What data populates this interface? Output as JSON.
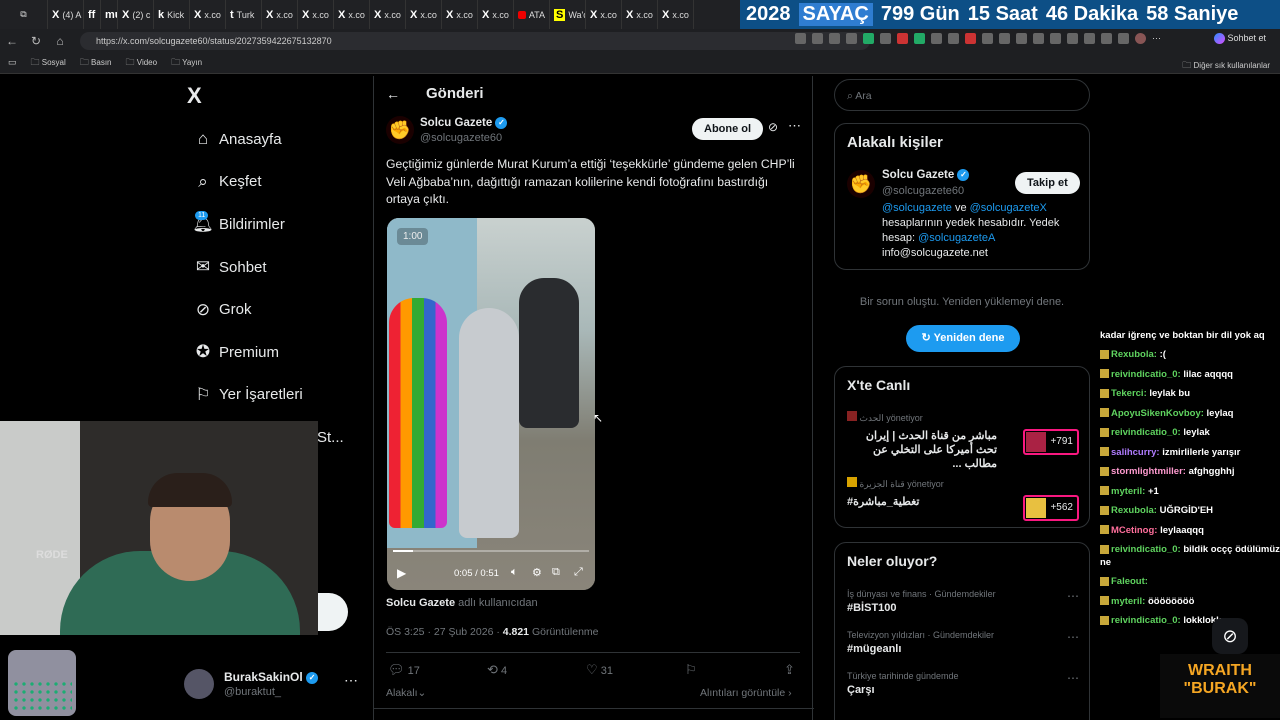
{
  "browser": {
    "tabs": [
      {
        "label": "(4) A",
        "icon": "X"
      },
      {
        "label": "",
        "icon": "ff"
      },
      {
        "label": "",
        "icon": "mute"
      },
      {
        "label": "(2) c",
        "icon": "X"
      },
      {
        "label": "Kick",
        "icon": "k"
      },
      {
        "label": "x.co",
        "icon": "X"
      },
      {
        "label": "Turk",
        "icon": "t"
      },
      {
        "label": "x.co",
        "icon": "X"
      },
      {
        "label": "x.co",
        "icon": "X"
      },
      {
        "label": "x.co",
        "icon": "X"
      },
      {
        "label": "x.co",
        "icon": "X"
      },
      {
        "label": "x.co",
        "icon": "X"
      },
      {
        "label": "x.co",
        "icon": "X"
      },
      {
        "label": "x.co",
        "icon": "X"
      },
      {
        "label": "ATA",
        "icon": "yt"
      },
      {
        "label": "Wa'c",
        "icon": "S"
      },
      {
        "label": "x.co",
        "icon": "X"
      },
      {
        "label": "x.co",
        "icon": "X"
      },
      {
        "label": "x.co",
        "icon": "X"
      }
    ],
    "url": "https://x.com/solcugazete60/status/2027359422675132870",
    "copilot_label": "Sohbet et",
    "bookmarks": [
      "Sosyal",
      "Basın",
      "Video",
      "Yayın"
    ],
    "other_bookmarks": "Diğer sık kullanılanlar"
  },
  "counter": {
    "year": "2028",
    "label": "SAYAÇ",
    "days": "799 Gün",
    "hours": "15 Saat",
    "minutes": "46 Dakika",
    "seconds": "58 Saniye"
  },
  "nav": {
    "logo": "X",
    "items": [
      {
        "label": "Anasayfa",
        "icon": "home-icon"
      },
      {
        "label": "Keşfet",
        "icon": "search-icon"
      },
      {
        "label": "Bildirimler",
        "icon": "bell-icon",
        "badge": "11"
      },
      {
        "label": "Sohbet",
        "icon": "mail-icon"
      },
      {
        "label": "Grok",
        "icon": "grok-icon"
      },
      {
        "label": "Premium",
        "icon": "premium-icon"
      },
      {
        "label": "Yer İşaretleri",
        "icon": "bookmark-icon"
      }
    ],
    "more_partial": "St...",
    "user": {
      "name": "BurakSakinOl",
      "handle": "@buraktut_"
    }
  },
  "post": {
    "header": "Gönderi",
    "author": {
      "name": "Solcu Gazete",
      "handle": "@solcugazete60"
    },
    "subscribe": "Abone ol",
    "text": "Geçtiğimiz günlerde Murat Kurum’a ettiği ‘teşekkürle’ gündeme gelen CHP’li Veli Ağbaba’nın, dağıttığı ramazan kolilerine kendi fotoğrafını bastırdığı ortaya çıktı.",
    "video": {
      "overlay_time": "1:00",
      "time": "0:05 / 0:51",
      "progress": 0.1
    },
    "from_user": "Solcu Gazete",
    "from_suffix": "adlı kullanıcıdan",
    "timestamp": "ÖS 3:25 · 27 Şub 2026 ·",
    "views": "4.821",
    "views_label": "Görüntülenme",
    "stats": {
      "replies": "17",
      "reposts": "4",
      "likes": "31"
    },
    "related": "Alakalı",
    "quotes": "Alıntıları görüntüle"
  },
  "right": {
    "search_placeholder": "Ara",
    "related_title": "Alakalı kişiler",
    "person": {
      "name": "Solcu Gazete",
      "handle": "@solcugazete60",
      "follow": "Takip et",
      "bio_link1": "@solcugazete",
      "bio_and": "ve",
      "bio_link2": "@solcugazeteX",
      "bio_text": "hesaplarının yedek hesabıdır. Yedek hesap:",
      "bio_link3": "@solcugazeteA",
      "bio_email": "info@solcugazete.net"
    },
    "error": "Bir sorun oluştu. Yeniden yüklemeyi dene.",
    "retry": "Yeniden dene",
    "live_title": "X'te Canlı",
    "live": [
      {
        "host": "الحدث",
        "role": "yönetiyor",
        "title": "مباشر من قناة الحدث | إيران تحث أميركا على التخلي عن مطالب ...",
        "count": "+791"
      },
      {
        "host": "قناة الجزيرة",
        "role": "yönetiyor",
        "title": "#تغطية_مباشرة",
        "count": "+562"
      }
    ],
    "trends_title": "Neler oluyor?",
    "trends": [
      {
        "cat": "İş dünyası ve finans · Gündemdekiler",
        "title": "#BİST100"
      },
      {
        "cat": "Televizyon yıldızları · Gündemdekiler",
        "title": "#mügeanlı"
      },
      {
        "cat": "Türkiye tarihinde gündemde",
        "title": "Çarşı"
      }
    ]
  },
  "chat": [
    {
      "user": "",
      "text": "kadar iğrenç ve boktan bir dil yok aq",
      "color": "#ffffff"
    },
    {
      "user": "Rexubola:",
      "text": ":(",
      "color": "#5fd35f"
    },
    {
      "user": "reivindicatio_0:",
      "text": "lilac aqqqq",
      "color": "#5fd35f"
    },
    {
      "user": "Tekerci:",
      "text": "leylak bu",
      "color": "#5fd35f"
    },
    {
      "user": "ApoyuSikenKovboy:",
      "text": "leylaq",
      "color": "#5fd35f"
    },
    {
      "user": "reivindicatio_0:",
      "text": "leylak",
      "color": "#5fd35f"
    },
    {
      "user": "salihcurry:",
      "text": "izmirlilerle yarışır",
      "color": "#b07cff"
    },
    {
      "user": "stormlightmiller:",
      "text": "afghgghhj",
      "color": "#ff9bd0"
    },
    {
      "user": "myteril:",
      "text": "+1",
      "color": "#5fd35f"
    },
    {
      "user": "Rexubola:",
      "text": "UĞRGİD'EH",
      "color": "#5fd35f"
    },
    {
      "user": "MCetinog:",
      "text": "leylaaqqq",
      "color": "#ff6f9c"
    },
    {
      "user": "reivindicatio_0:",
      "text": "bildik ocçç ödülümüz ne",
      "color": "#5fd35f"
    },
    {
      "user": "Faleout:",
      "text": "",
      "color": "#5fd35f"
    },
    {
      "user": "myteril:",
      "text": "öööööööö",
      "color": "#5fd35f"
    },
    {
      "user": "reivindicatio_0:",
      "text": "lokklokk",
      "color": "#5fd35f"
    }
  ],
  "overlay": {
    "brand1": "WRAITH",
    "brand2": "\"BURAK\"",
    "mic": "RØDE"
  }
}
